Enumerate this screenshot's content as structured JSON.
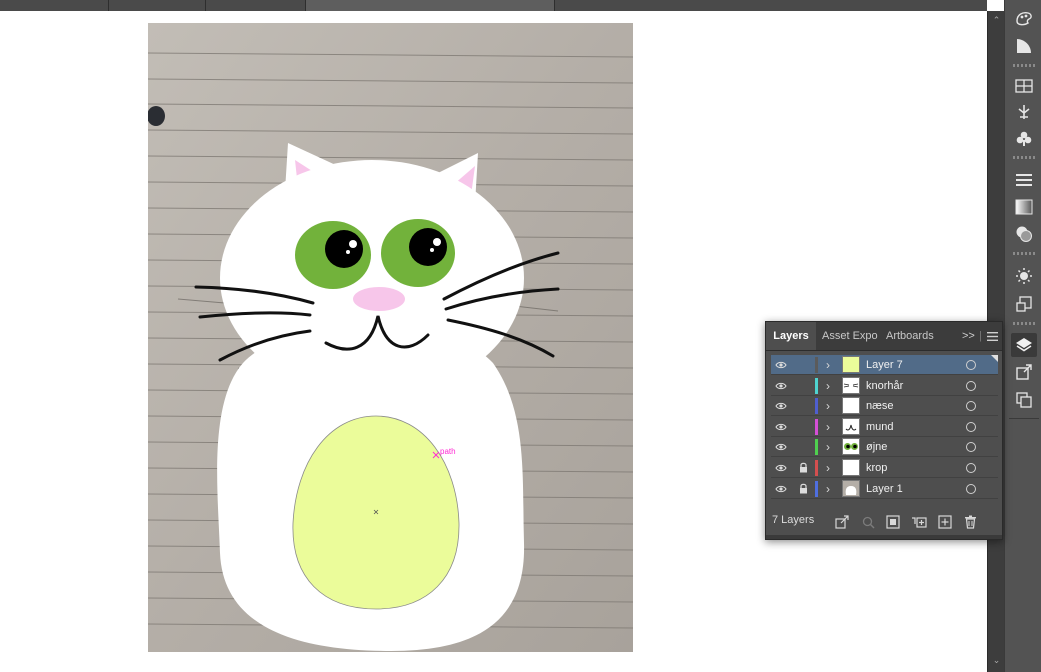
{
  "document_tabs": [
    {
      "label": "",
      "active": false
    },
    {
      "label": "",
      "active": false
    },
    {
      "label": "",
      "active": false
    },
    {
      "label": "",
      "active": true
    }
  ],
  "canvas": {
    "path_label": "path"
  },
  "layers_panel": {
    "tabs": [
      "Layers",
      "Asset Expo",
      "Artboards"
    ],
    "active_tab": "Layers",
    "overflow_label": ">>",
    "menu_icon": "hamburger-menu-icon",
    "layer_count": "7 Layers",
    "layers": [
      {
        "name": "Layer 7",
        "color": "#5b5b5b",
        "selected": true,
        "locked": false,
        "visible": true,
        "thumb": "pale-egg"
      },
      {
        "name": "knorhår",
        "color": "#4fd4d0",
        "selected": false,
        "locked": false,
        "visible": true,
        "thumb": "whiskers"
      },
      {
        "name": "næse",
        "color": "#4f5fcf",
        "selected": false,
        "locked": false,
        "visible": true,
        "thumb": "blank"
      },
      {
        "name": "mund",
        "color": "#d44fd6",
        "selected": false,
        "locked": false,
        "visible": true,
        "thumb": "mouth"
      },
      {
        "name": "øjne",
        "color": "#4fd04f",
        "selected": false,
        "locked": false,
        "visible": true,
        "thumb": "eyes"
      },
      {
        "name": "krop",
        "color": "#d44f4f",
        "selected": false,
        "locked": true,
        "visible": true,
        "thumb": "blank"
      },
      {
        "name": "Layer 1",
        "color": "#4f6fdf",
        "selected": false,
        "locked": true,
        "visible": true,
        "thumb": "photo"
      }
    ],
    "footer_icons": [
      "export-icon",
      "search-icon",
      "clipping-mask-icon",
      "new-sublayer-icon",
      "new-layer-icon",
      "trash-icon"
    ]
  },
  "dock_icons": [
    "color-themes-icon",
    "gradient-guide-icon",
    "libraries-icon",
    "puppet-warp-icon",
    "symbols-icon",
    "stroke-icon",
    "gradient-icon",
    "transparency-icon",
    "appearance-icon",
    "graphic-styles-icon",
    "layers-icon",
    "export-asset-icon",
    "artboards-icon"
  ]
}
